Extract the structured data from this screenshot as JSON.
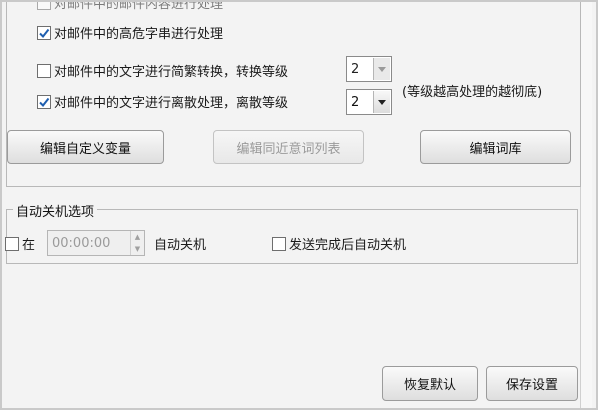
{
  "options": {
    "top_cut_label": "对邮件中的邮件内容进行处理",
    "high_risk": {
      "label": "对邮件中的高危字串进行处理",
      "checked": true
    },
    "simplified": {
      "label": "对邮件中的文字进行简繁转换，转换等级",
      "checked": false,
      "level": "2"
    },
    "discrete": {
      "label": "对邮件中的文字进行离散处理，离散等级",
      "checked": true,
      "level": "2"
    },
    "level_note": "(等级越高处理的越彻底)"
  },
  "buttons": {
    "edit_custom_vars": "编辑自定义变量",
    "edit_synonyms": "编辑同近意词列表",
    "edit_dictionary": "编辑词库"
  },
  "shutdown": {
    "title": "自动关机选项",
    "at_label": "在",
    "at_checked": false,
    "time_value": "00:00:00",
    "auto_shutdown_label": "自动关机",
    "after_send_label": "发送完成后自动关机",
    "after_send_checked": false
  },
  "footer": {
    "restore_default": "恢复默认",
    "save_settings": "保存设置"
  }
}
